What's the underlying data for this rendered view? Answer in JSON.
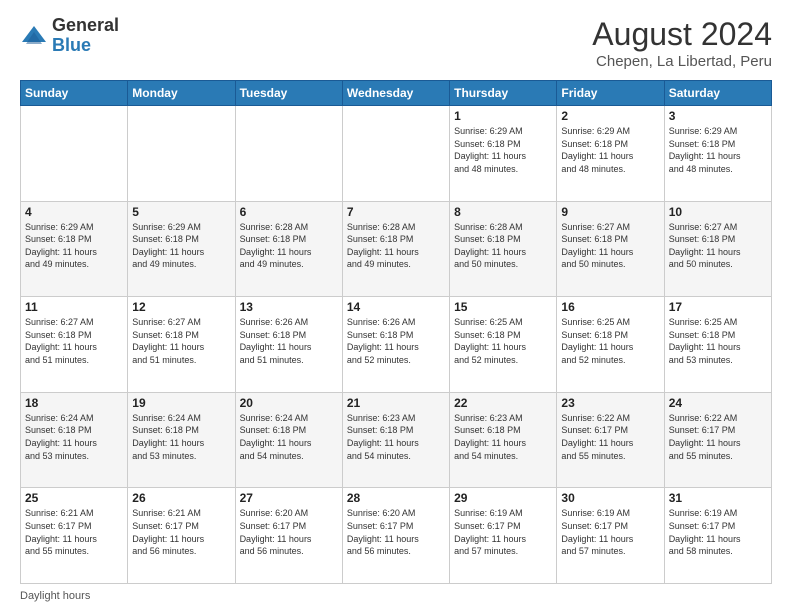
{
  "header": {
    "logo": {
      "general": "General",
      "blue": "Blue"
    },
    "title": "August 2024",
    "location": "Chepen, La Libertad, Peru"
  },
  "calendar": {
    "days_of_week": [
      "Sunday",
      "Monday",
      "Tuesday",
      "Wednesday",
      "Thursday",
      "Friday",
      "Saturday"
    ],
    "weeks": [
      [
        {
          "day": "",
          "info": ""
        },
        {
          "day": "",
          "info": ""
        },
        {
          "day": "",
          "info": ""
        },
        {
          "day": "",
          "info": ""
        },
        {
          "day": "1",
          "info": "Sunrise: 6:29 AM\nSunset: 6:18 PM\nDaylight: 11 hours\nand 48 minutes."
        },
        {
          "day": "2",
          "info": "Sunrise: 6:29 AM\nSunset: 6:18 PM\nDaylight: 11 hours\nand 48 minutes."
        },
        {
          "day": "3",
          "info": "Sunrise: 6:29 AM\nSunset: 6:18 PM\nDaylight: 11 hours\nand 48 minutes."
        }
      ],
      [
        {
          "day": "4",
          "info": "Sunrise: 6:29 AM\nSunset: 6:18 PM\nDaylight: 11 hours\nand 49 minutes."
        },
        {
          "day": "5",
          "info": "Sunrise: 6:29 AM\nSunset: 6:18 PM\nDaylight: 11 hours\nand 49 minutes."
        },
        {
          "day": "6",
          "info": "Sunrise: 6:28 AM\nSunset: 6:18 PM\nDaylight: 11 hours\nand 49 minutes."
        },
        {
          "day": "7",
          "info": "Sunrise: 6:28 AM\nSunset: 6:18 PM\nDaylight: 11 hours\nand 49 minutes."
        },
        {
          "day": "8",
          "info": "Sunrise: 6:28 AM\nSunset: 6:18 PM\nDaylight: 11 hours\nand 50 minutes."
        },
        {
          "day": "9",
          "info": "Sunrise: 6:27 AM\nSunset: 6:18 PM\nDaylight: 11 hours\nand 50 minutes."
        },
        {
          "day": "10",
          "info": "Sunrise: 6:27 AM\nSunset: 6:18 PM\nDaylight: 11 hours\nand 50 minutes."
        }
      ],
      [
        {
          "day": "11",
          "info": "Sunrise: 6:27 AM\nSunset: 6:18 PM\nDaylight: 11 hours\nand 51 minutes."
        },
        {
          "day": "12",
          "info": "Sunrise: 6:27 AM\nSunset: 6:18 PM\nDaylight: 11 hours\nand 51 minutes."
        },
        {
          "day": "13",
          "info": "Sunrise: 6:26 AM\nSunset: 6:18 PM\nDaylight: 11 hours\nand 51 minutes."
        },
        {
          "day": "14",
          "info": "Sunrise: 6:26 AM\nSunset: 6:18 PM\nDaylight: 11 hours\nand 52 minutes."
        },
        {
          "day": "15",
          "info": "Sunrise: 6:25 AM\nSunset: 6:18 PM\nDaylight: 11 hours\nand 52 minutes."
        },
        {
          "day": "16",
          "info": "Sunrise: 6:25 AM\nSunset: 6:18 PM\nDaylight: 11 hours\nand 52 minutes."
        },
        {
          "day": "17",
          "info": "Sunrise: 6:25 AM\nSunset: 6:18 PM\nDaylight: 11 hours\nand 53 minutes."
        }
      ],
      [
        {
          "day": "18",
          "info": "Sunrise: 6:24 AM\nSunset: 6:18 PM\nDaylight: 11 hours\nand 53 minutes."
        },
        {
          "day": "19",
          "info": "Sunrise: 6:24 AM\nSunset: 6:18 PM\nDaylight: 11 hours\nand 53 minutes."
        },
        {
          "day": "20",
          "info": "Sunrise: 6:24 AM\nSunset: 6:18 PM\nDaylight: 11 hours\nand 54 minutes."
        },
        {
          "day": "21",
          "info": "Sunrise: 6:23 AM\nSunset: 6:18 PM\nDaylight: 11 hours\nand 54 minutes."
        },
        {
          "day": "22",
          "info": "Sunrise: 6:23 AM\nSunset: 6:18 PM\nDaylight: 11 hours\nand 54 minutes."
        },
        {
          "day": "23",
          "info": "Sunrise: 6:22 AM\nSunset: 6:17 PM\nDaylight: 11 hours\nand 55 minutes."
        },
        {
          "day": "24",
          "info": "Sunrise: 6:22 AM\nSunset: 6:17 PM\nDaylight: 11 hours\nand 55 minutes."
        }
      ],
      [
        {
          "day": "25",
          "info": "Sunrise: 6:21 AM\nSunset: 6:17 PM\nDaylight: 11 hours\nand 55 minutes."
        },
        {
          "day": "26",
          "info": "Sunrise: 6:21 AM\nSunset: 6:17 PM\nDaylight: 11 hours\nand 56 minutes."
        },
        {
          "day": "27",
          "info": "Sunrise: 6:20 AM\nSunset: 6:17 PM\nDaylight: 11 hours\nand 56 minutes."
        },
        {
          "day": "28",
          "info": "Sunrise: 6:20 AM\nSunset: 6:17 PM\nDaylight: 11 hours\nand 56 minutes."
        },
        {
          "day": "29",
          "info": "Sunrise: 6:19 AM\nSunset: 6:17 PM\nDaylight: 11 hours\nand 57 minutes."
        },
        {
          "day": "30",
          "info": "Sunrise: 6:19 AM\nSunset: 6:17 PM\nDaylight: 11 hours\nand 57 minutes."
        },
        {
          "day": "31",
          "info": "Sunrise: 6:19 AM\nSunset: 6:17 PM\nDaylight: 11 hours\nand 58 minutes."
        }
      ]
    ]
  },
  "footer": {
    "daylight_label": "Daylight hours"
  }
}
